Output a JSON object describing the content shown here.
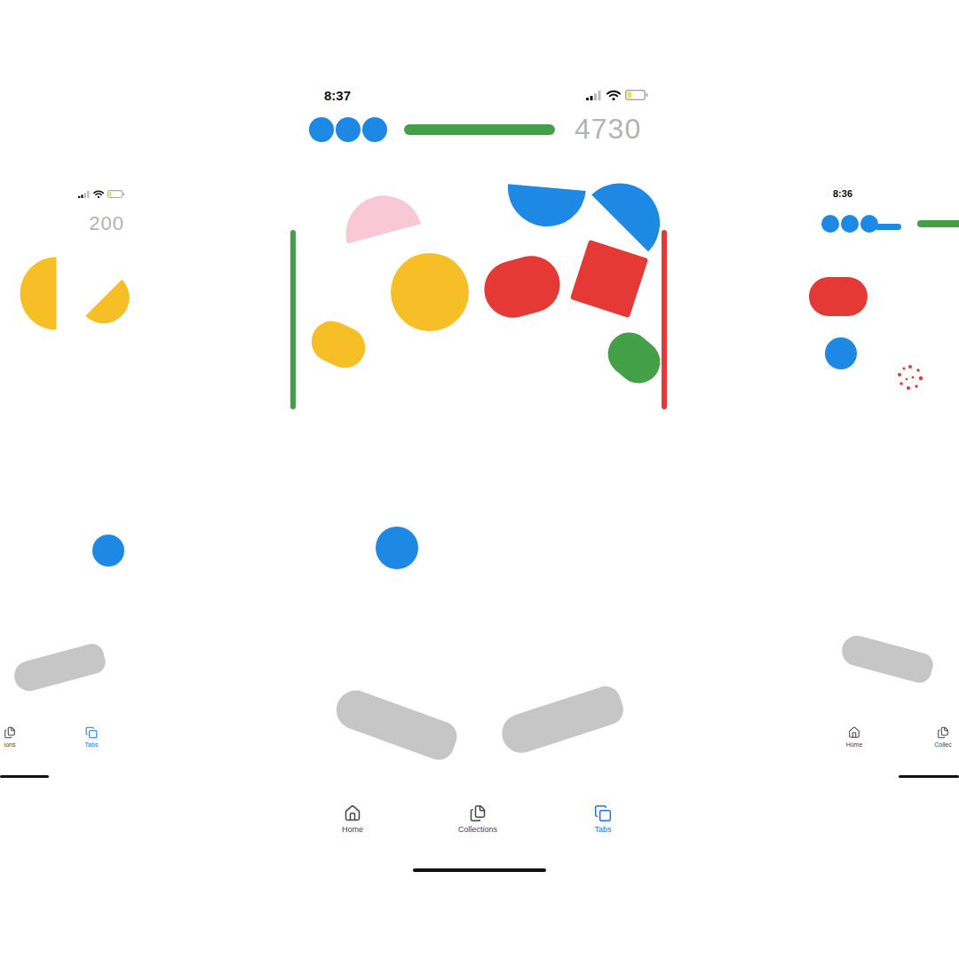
{
  "screens": [
    {
      "score": "200",
      "battery_level": 0.2,
      "bumpers": [
        {
          "kind": "half-disc",
          "color": "#f6bf26"
        },
        {
          "kind": "half-disc",
          "color": "#f6bf26"
        }
      ],
      "ball": {
        "color": "#1e88e5"
      },
      "tabs": [
        {
          "label": "ions",
          "selected": false
        },
        {
          "label": "Tabs",
          "selected": true
        }
      ]
    },
    {
      "time": "8:37",
      "score": "4730",
      "lives": 3,
      "battery_level": 0.25,
      "bumpers": [
        {
          "kind": "half-disc",
          "color": "#f8c8d4"
        },
        {
          "kind": "half-disc",
          "color": "#1e88e5"
        },
        {
          "kind": "half-disc",
          "color": "#1e88e5"
        },
        {
          "kind": "circle",
          "color": "#f6bf26"
        },
        {
          "kind": "pill",
          "color": "#e53935"
        },
        {
          "kind": "square",
          "color": "#e53935"
        },
        {
          "kind": "pill",
          "color": "#f6bf26"
        },
        {
          "kind": "pill",
          "color": "#43a047"
        }
      ],
      "walls": [
        {
          "color": "#43a047"
        },
        {
          "color": "#e53935"
        }
      ],
      "ball": {
        "color": "#1e88e5"
      },
      "tabs": [
        {
          "label": "Home",
          "selected": false
        },
        {
          "label": "Collections",
          "selected": false
        },
        {
          "label": "Tabs",
          "selected": true
        }
      ]
    },
    {
      "time": "8:36",
      "lives": 3,
      "bumpers": [
        {
          "kind": "pill",
          "color": "#e53935"
        }
      ],
      "ball": {
        "color": "#1e88e5"
      },
      "burst": {
        "color": "#e53935"
      },
      "tabs": [
        {
          "label": "Home",
          "selected": false
        },
        {
          "label": "Collec",
          "selected": false
        }
      ]
    }
  ]
}
